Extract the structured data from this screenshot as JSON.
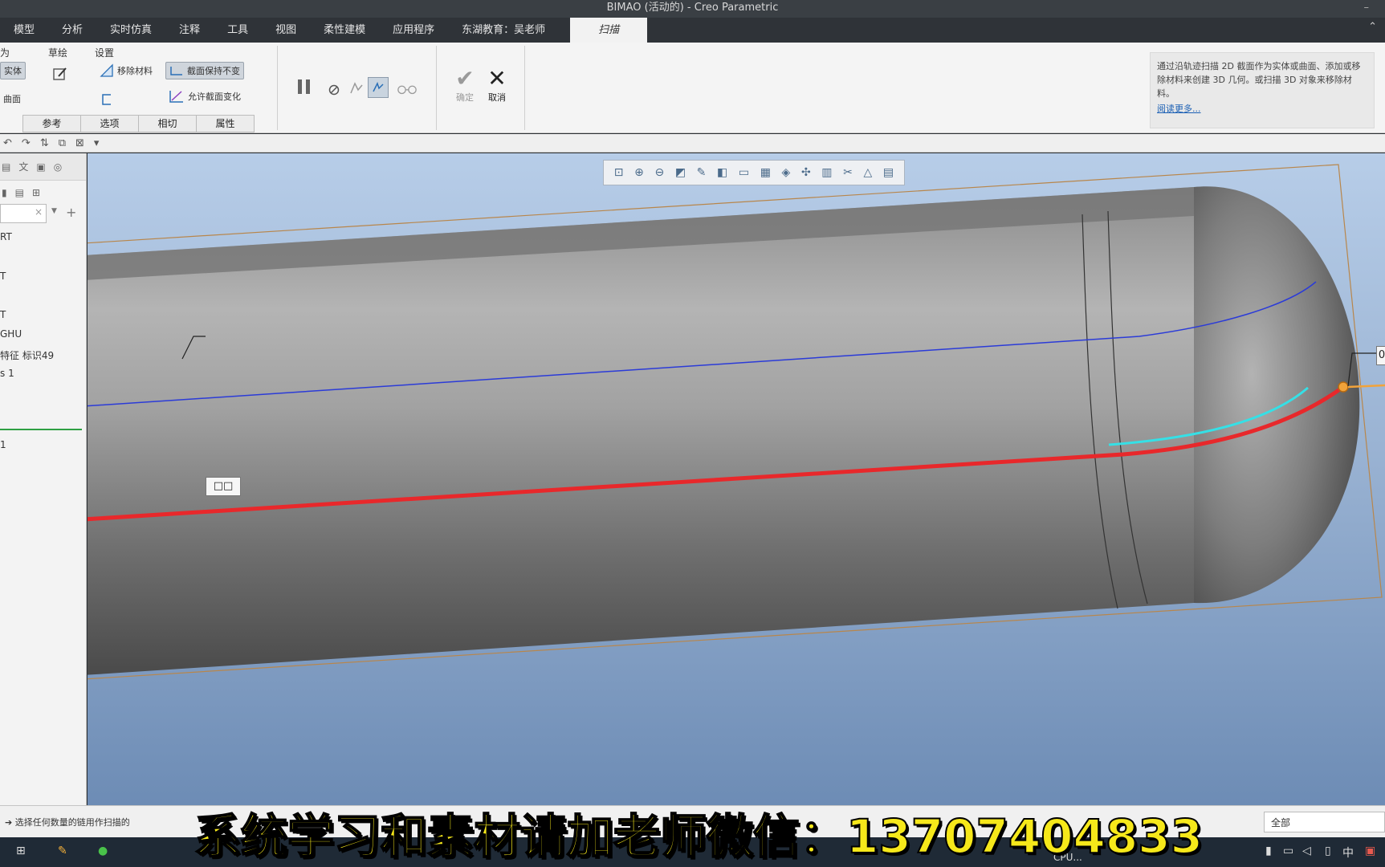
{
  "window": {
    "title": "BIMAO (活动的) - Creo Parametric",
    "minimize": "–"
  },
  "tabs": [
    "模型",
    "分析",
    "实时仿真",
    "注释",
    "工具",
    "视图",
    "柔性建模",
    "应用程序",
    "东湖教育：吴老师",
    "扫描"
  ],
  "active_tab": "扫描",
  "ribbon": {
    "group_as": "为",
    "group_sketch": "草绘",
    "group_settings": "设置",
    "solid": "实体",
    "surface": "曲面",
    "remove_material": "移除材料",
    "section_constant": "截面保持不变",
    "allow_section_change": "允许截面变化",
    "subtabs": [
      "参考",
      "选项",
      "相切",
      "属性"
    ],
    "ok": "确定",
    "cancel": "取消",
    "help_text": "通过沿轨迹扫描 2D 截面作为实体或曲面、添加或移除材料来创建 3D 几何。或扫描 3D 对象来移除材料。",
    "help_more": "阅读更多..."
  },
  "tree": {
    "header_tab": "文",
    "items": [
      "RT",
      "T",
      "T",
      "GHU",
      "特征 标识49",
      "s 1",
      "1"
    ]
  },
  "viewport": {
    "tag_label": "□□",
    "tag_label_right": "0",
    "model": "capsule-tank",
    "trajectory_color": "#e8282b",
    "curve_color": "#35e0e6",
    "edge_color": "#2b3bd8"
  },
  "status": {
    "message": "选择任何数量的链用作扫描的",
    "filter": "全部"
  },
  "taskbar": {
    "cpu": "CPU...",
    "ime": "中"
  },
  "subtitle": "系统学习和素材请加老师微信：13707404833"
}
